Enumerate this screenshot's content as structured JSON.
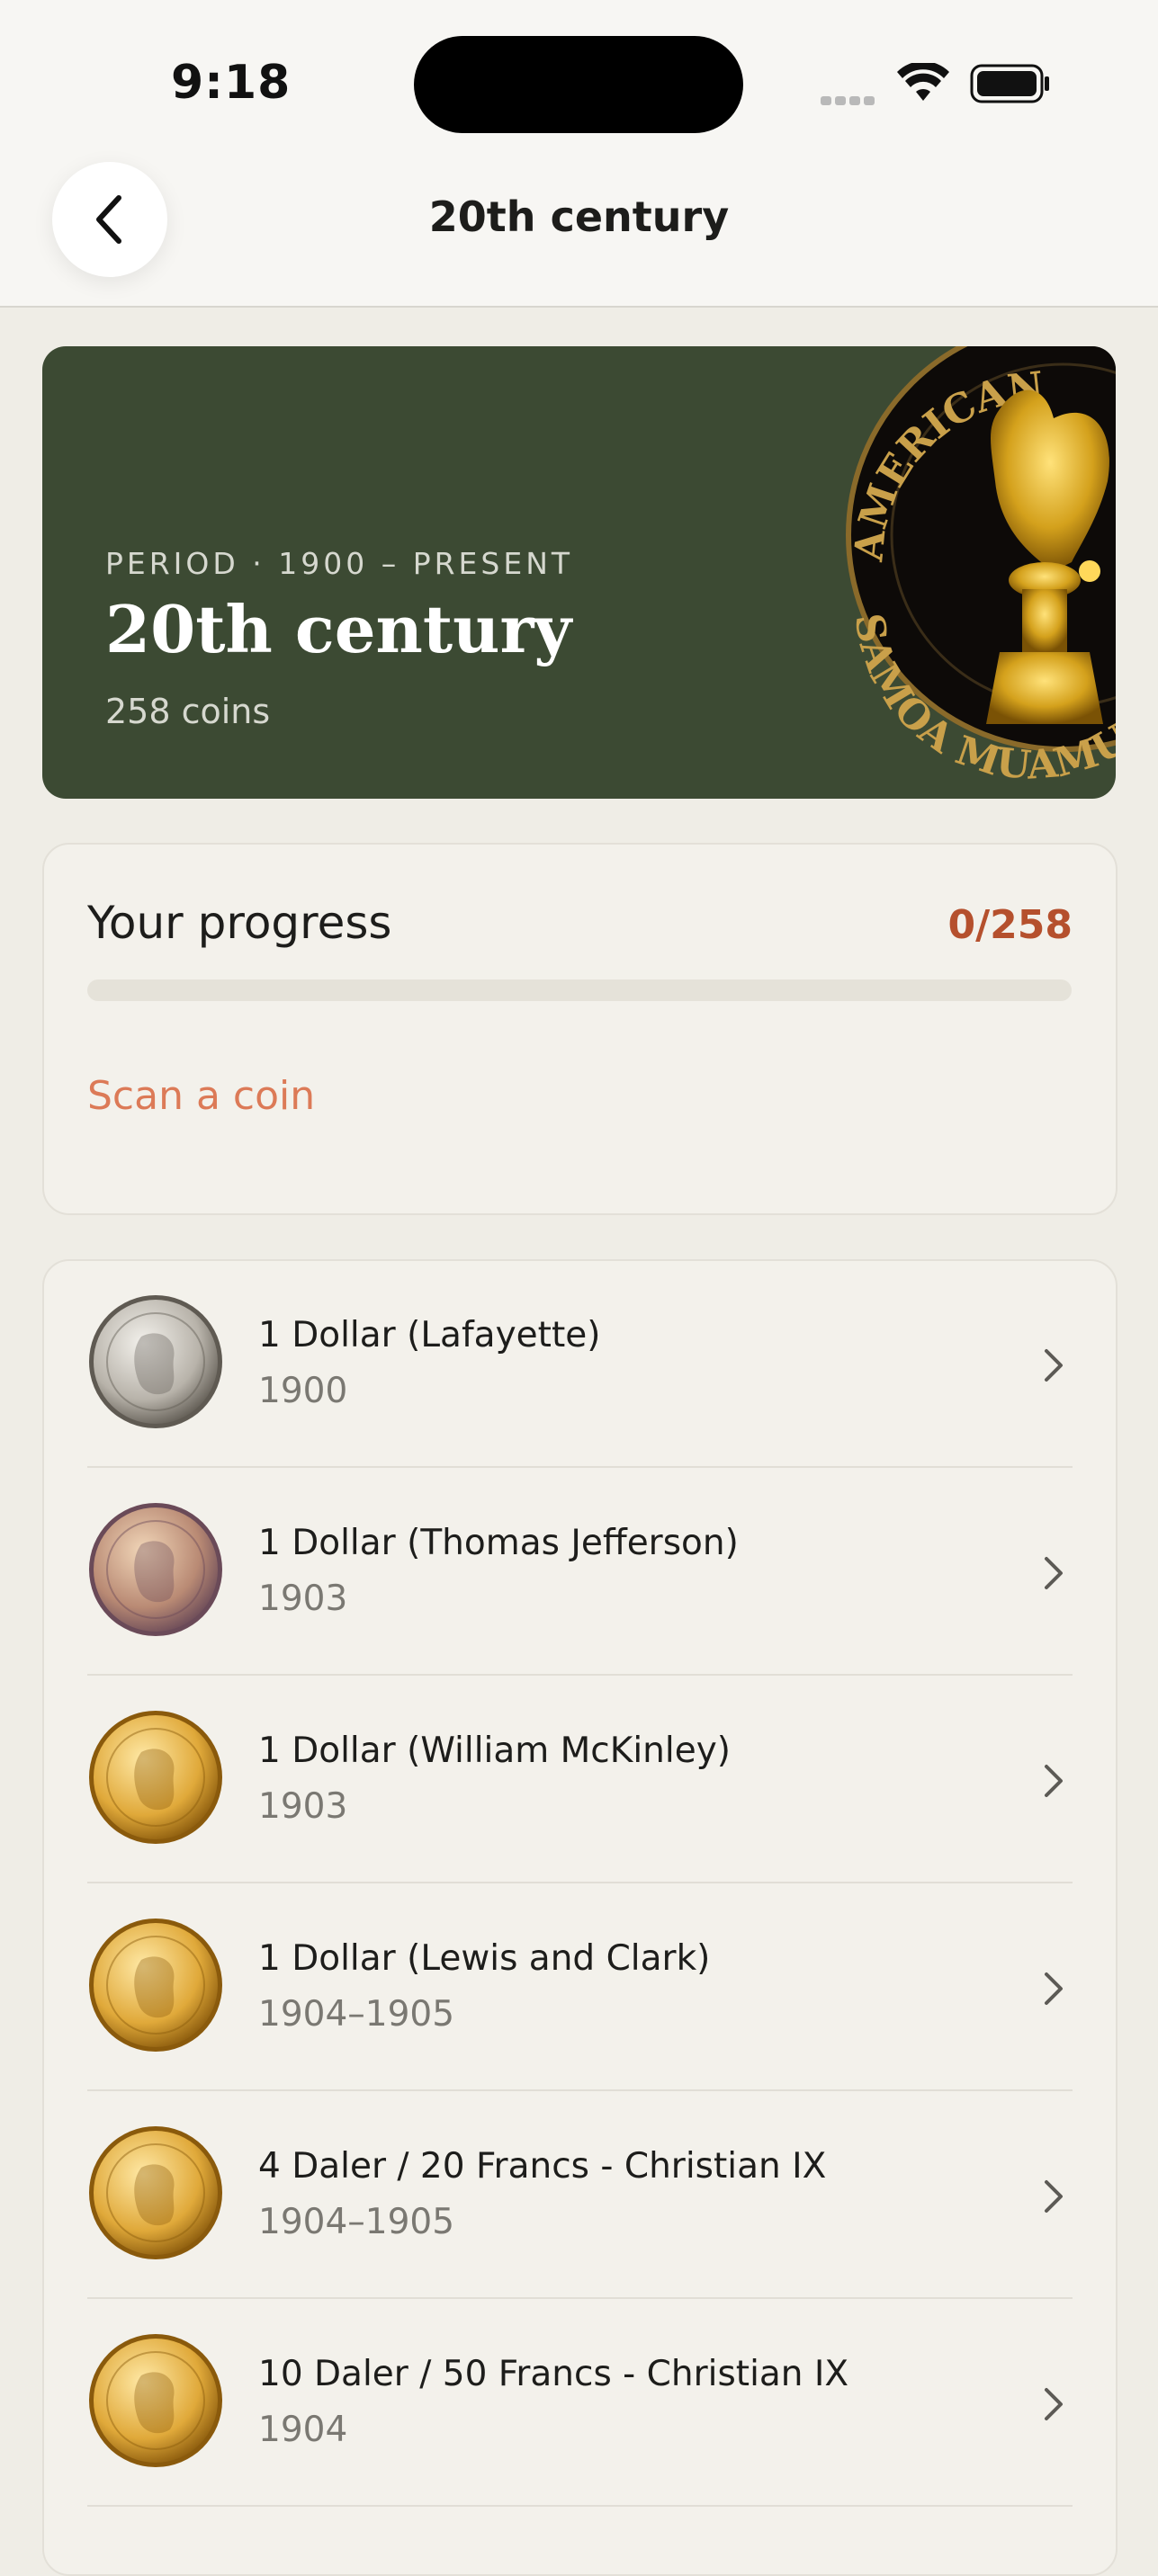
{
  "status_bar": {
    "time": "9:18"
  },
  "nav": {
    "title": "20th century"
  },
  "hero": {
    "eyebrow": "PERIOD · 1900 – PRESENT",
    "title": "20th century",
    "count": "258 coins",
    "coin_text_top": "AMERICAN",
    "coin_text_bottom": "SAMOA MUAMUA"
  },
  "progress": {
    "label": "Your progress",
    "count": "0/258",
    "fraction": 0,
    "scan_label": "Scan a coin"
  },
  "coins": [
    {
      "name": "1 Dollar (Lafayette)",
      "year": "1900",
      "metal": "silver"
    },
    {
      "name": "1 Dollar (Thomas Jefferson)",
      "year": "1903",
      "metal": "rose"
    },
    {
      "name": "1 Dollar (William McKinley)",
      "year": "1903",
      "metal": "gold"
    },
    {
      "name": "1 Dollar (Lewis and Clark)",
      "year": "1904–1905",
      "metal": "gold"
    },
    {
      "name": "4 Daler / 20 Francs - Christian IX",
      "year": "1904–1905",
      "metal": "gold"
    },
    {
      "name": "10 Daler / 50 Francs - Christian IX",
      "year": "1904",
      "metal": "gold"
    }
  ],
  "colors": {
    "background": "#efede6",
    "hero": "#3c4a33",
    "accent": "#b5502d",
    "link": "#dc7a57"
  }
}
